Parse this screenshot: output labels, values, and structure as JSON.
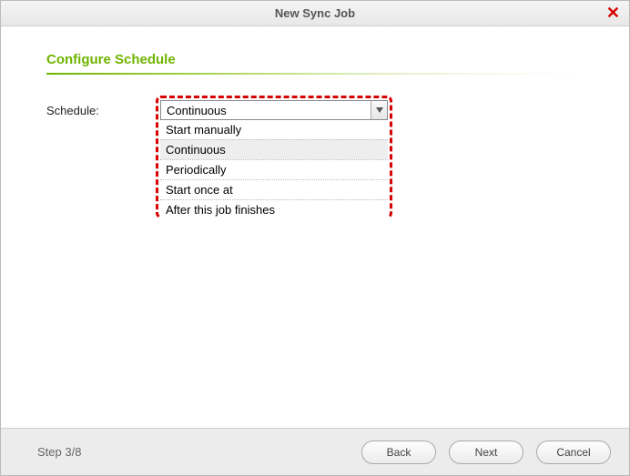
{
  "dialog": {
    "title": "New Sync Job"
  },
  "section": {
    "heading": "Configure Schedule"
  },
  "form": {
    "schedule_label": "Schedule:"
  },
  "schedule_select": {
    "value": "Continuous",
    "options": [
      "Start manually",
      "Continuous",
      "Periodically",
      "Start once at",
      "After this job finishes"
    ],
    "selected_index": 1
  },
  "footer": {
    "step_text": "Step 3/8",
    "back_label": "Back",
    "next_label": "Next",
    "cancel_label": "Cancel"
  }
}
